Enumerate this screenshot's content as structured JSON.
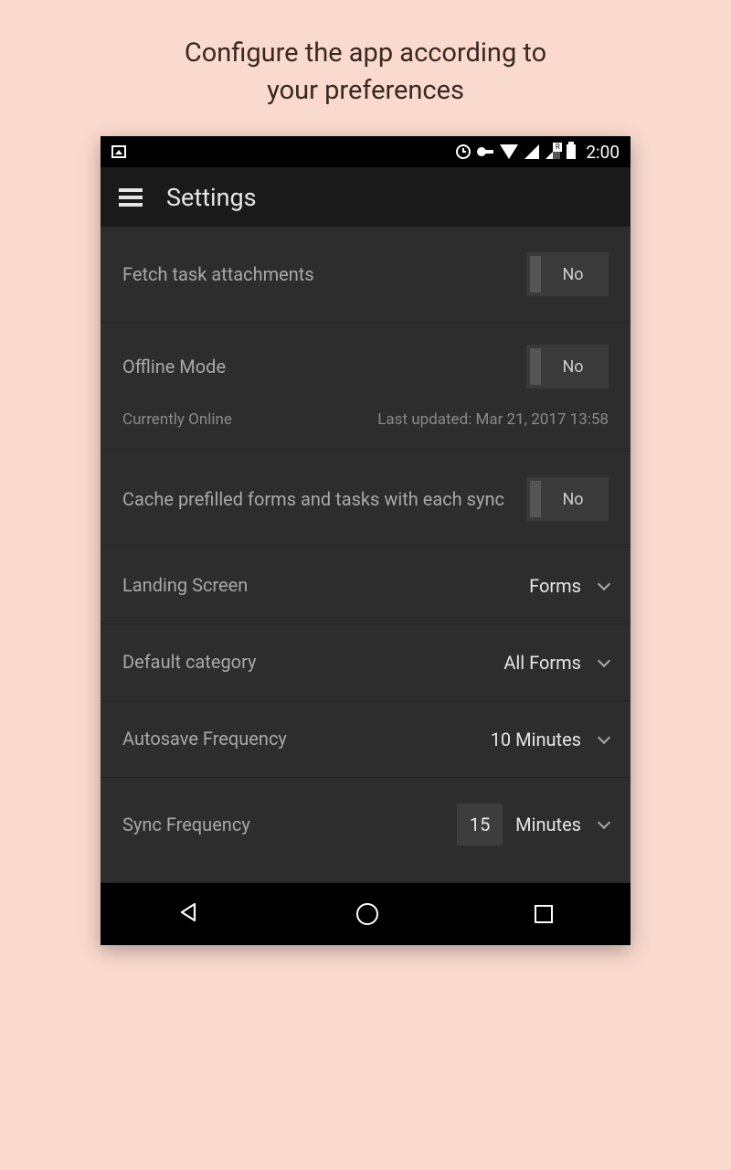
{
  "promo": {
    "line1": "Configure the app according to",
    "line2": "your preferences"
  },
  "status": {
    "time": "2:00"
  },
  "appbar": {
    "title": "Settings"
  },
  "settings": {
    "fetch_attachments": {
      "label": "Fetch task attachments",
      "value": "No"
    },
    "offline_mode": {
      "label": "Offline Mode",
      "value": "No",
      "status": "Currently Online",
      "last_updated": "Last updated: Mar 21, 2017 13:58"
    },
    "cache_prefilled": {
      "label": "Cache prefilled forms and tasks with each sync",
      "value": "No"
    },
    "landing_screen": {
      "label": "Landing Screen",
      "value": "Forms"
    },
    "default_category": {
      "label": "Default category",
      "value": "All Forms"
    },
    "autosave": {
      "label": "Autosave Frequency",
      "value": "10 Minutes"
    },
    "sync": {
      "label": "Sync Frequency",
      "number": "15",
      "unit": "Minutes"
    }
  }
}
